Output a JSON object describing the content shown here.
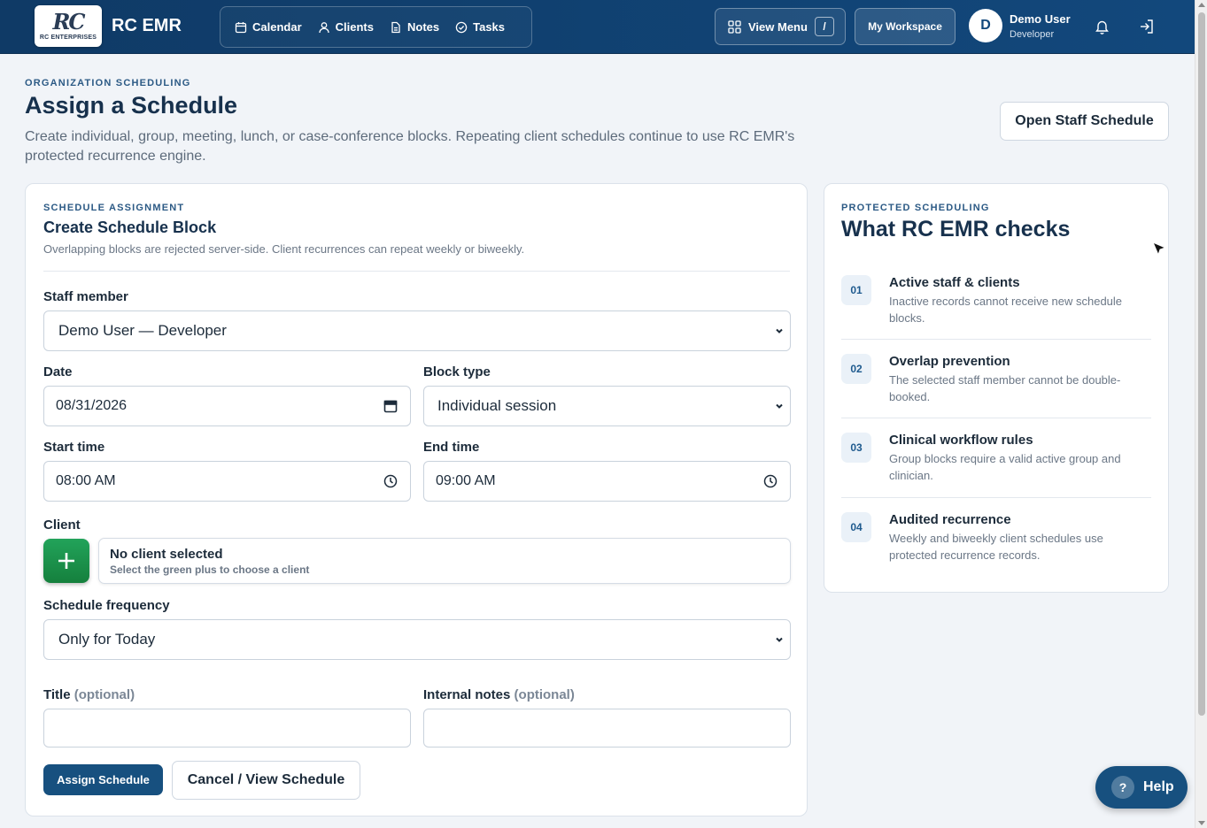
{
  "header": {
    "logo_mark": "RC",
    "logo_sub": "RC ENTERPRISES",
    "brand": "RC EMR",
    "nav": [
      {
        "label": "Calendar",
        "icon": "calendar-icon"
      },
      {
        "label": "Clients",
        "icon": "user-icon"
      },
      {
        "label": "Notes",
        "icon": "document-icon"
      },
      {
        "label": "Tasks",
        "icon": "check-circle-icon"
      }
    ],
    "view_menu_label": "View Menu",
    "view_menu_shortcut": "/",
    "workspace_label": "My Workspace",
    "user": {
      "initial": "D",
      "name": "Demo User",
      "role": "Developer"
    }
  },
  "page": {
    "eyebrow": "ORGANIZATION SCHEDULING",
    "title": "Assign a Schedule",
    "description": "Create individual, group, meeting, lunch, or case-conference blocks. Repeating client schedules continue to use RC EMR's protected recurrence engine.",
    "open_staff_label": "Open Staff Schedule"
  },
  "form": {
    "eyebrow": "SCHEDULE ASSIGNMENT",
    "title": "Create Schedule Block",
    "description": "Overlapping blocks are rejected server-side. Client recurrences can repeat weekly or biweekly.",
    "staff_label": "Staff member",
    "staff_value": "Demo User — Developer",
    "date_label": "Date",
    "date_value": "08/31/2026",
    "block_type_label": "Block type",
    "block_type_value": "Individual session",
    "start_label": "Start time",
    "start_value": "08:00 AM",
    "end_label": "End time",
    "end_value": "09:00 AM",
    "client_label": "Client",
    "client_main": "No client selected",
    "client_sub": "Select the green plus to choose a client",
    "frequency_label": "Schedule frequency",
    "frequency_value": "Only for Today",
    "title_label": "Title",
    "notes_label": "Internal notes",
    "optional": "(optional)",
    "title_value": "",
    "notes_value": "",
    "assign_label": "Assign Schedule",
    "cancel_label": "Cancel / View Schedule"
  },
  "side": {
    "eyebrow": "PROTECTED SCHEDULING",
    "title": "What RC EMR checks",
    "checks": [
      {
        "num": "01",
        "title": "Active staff & clients",
        "desc": "Inactive records cannot receive new schedule blocks."
      },
      {
        "num": "02",
        "title": "Overlap prevention",
        "desc": "The selected staff member cannot be double-booked."
      },
      {
        "num": "03",
        "title": "Clinical workflow rules",
        "desc": "Group blocks require a valid active group and clinician."
      },
      {
        "num": "04",
        "title": "Audited recurrence",
        "desc": "Weekly and biweekly client schedules use protected recurrence records."
      }
    ]
  },
  "help_label": "Help",
  "colors": {
    "header": "#12487c",
    "primary": "#17507f",
    "add": "#15803d"
  }
}
